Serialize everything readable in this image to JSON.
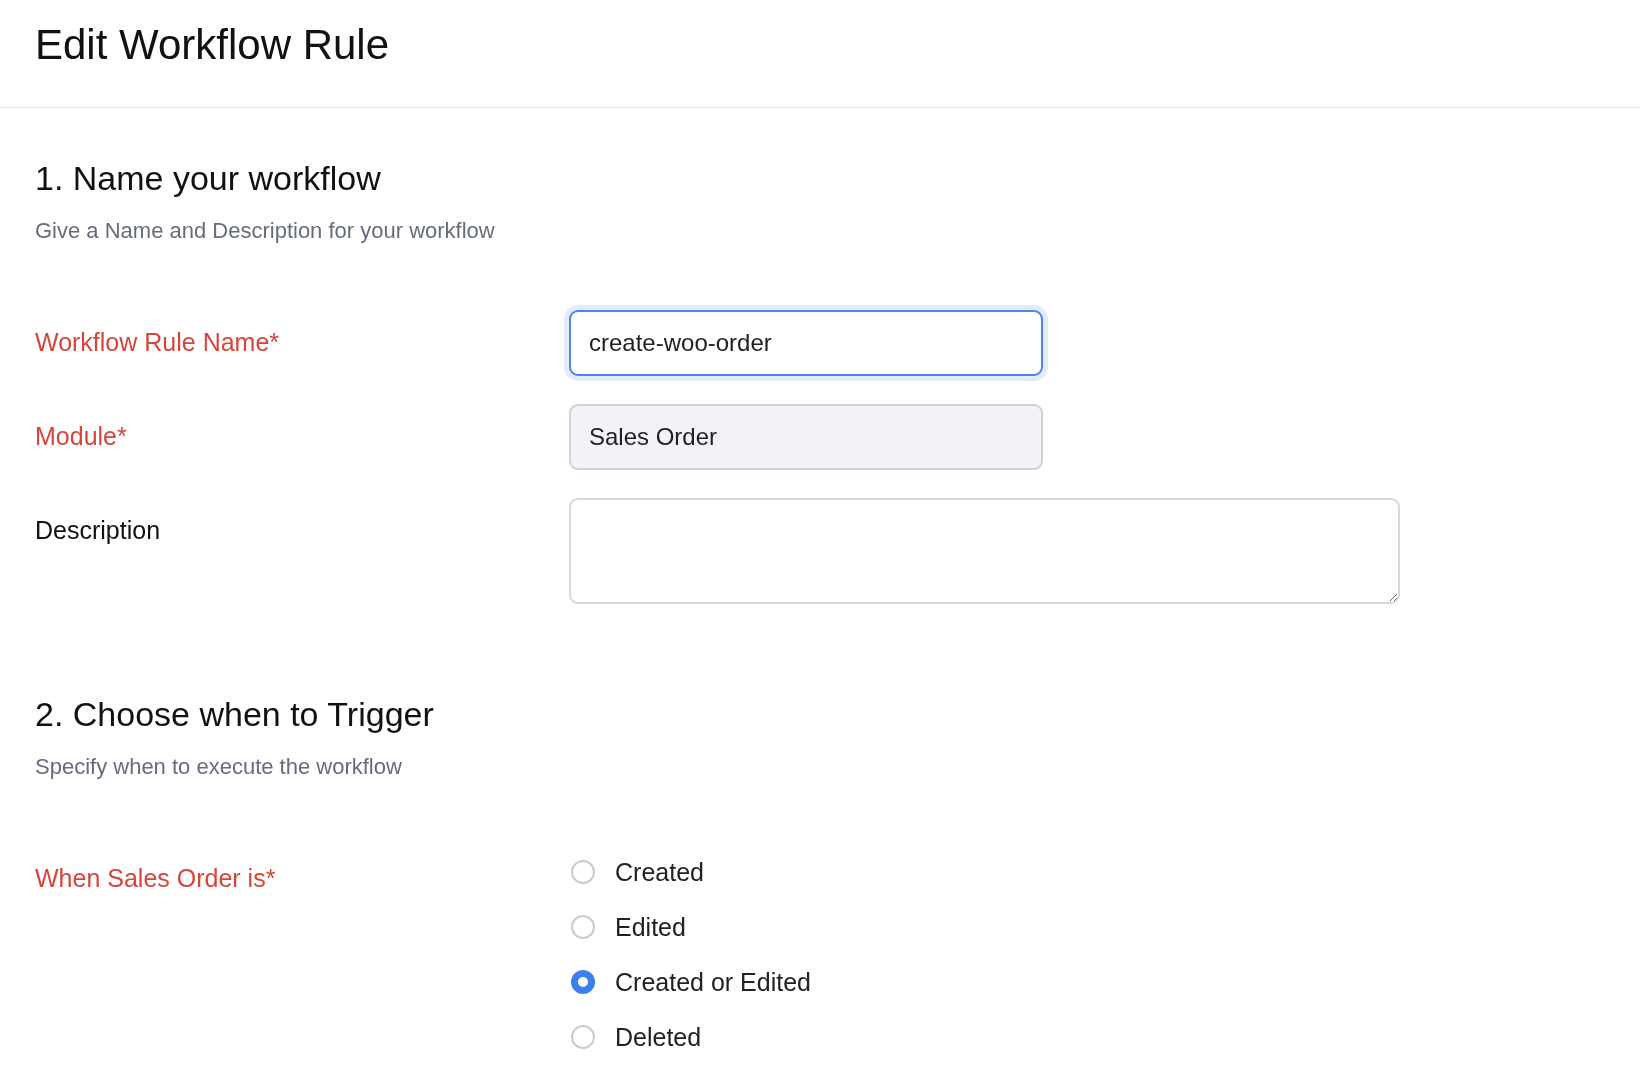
{
  "page": {
    "title": "Edit Workflow Rule"
  },
  "sections": [
    {
      "heading": "1. Name your workflow",
      "subtitle": "Give a Name and Description for your workflow",
      "fields": [
        {
          "kind": "text",
          "label": "Workflow Rule Name*",
          "required": true,
          "value": "create-woo-order",
          "focused": true
        },
        {
          "kind": "text",
          "label": "Module*",
          "required": true,
          "value": "Sales Order",
          "focused": false,
          "disabled": true
        },
        {
          "kind": "textarea",
          "label": "Description",
          "required": false,
          "focused": false
        }
      ]
    },
    {
      "heading": "2. Choose when to Trigger",
      "subtitle": "Specify when to execute the workflow",
      "fields": [
        {
          "kind": "radio",
          "label": "When Sales Order is*",
          "required": true,
          "options": [
            {
              "label": "Created",
              "selected": false
            },
            {
              "label": "Edited",
              "selected": false
            },
            {
              "label": "Created or Edited",
              "selected": true
            },
            {
              "label": "Deleted",
              "selected": false
            }
          ]
        }
      ]
    }
  ]
}
